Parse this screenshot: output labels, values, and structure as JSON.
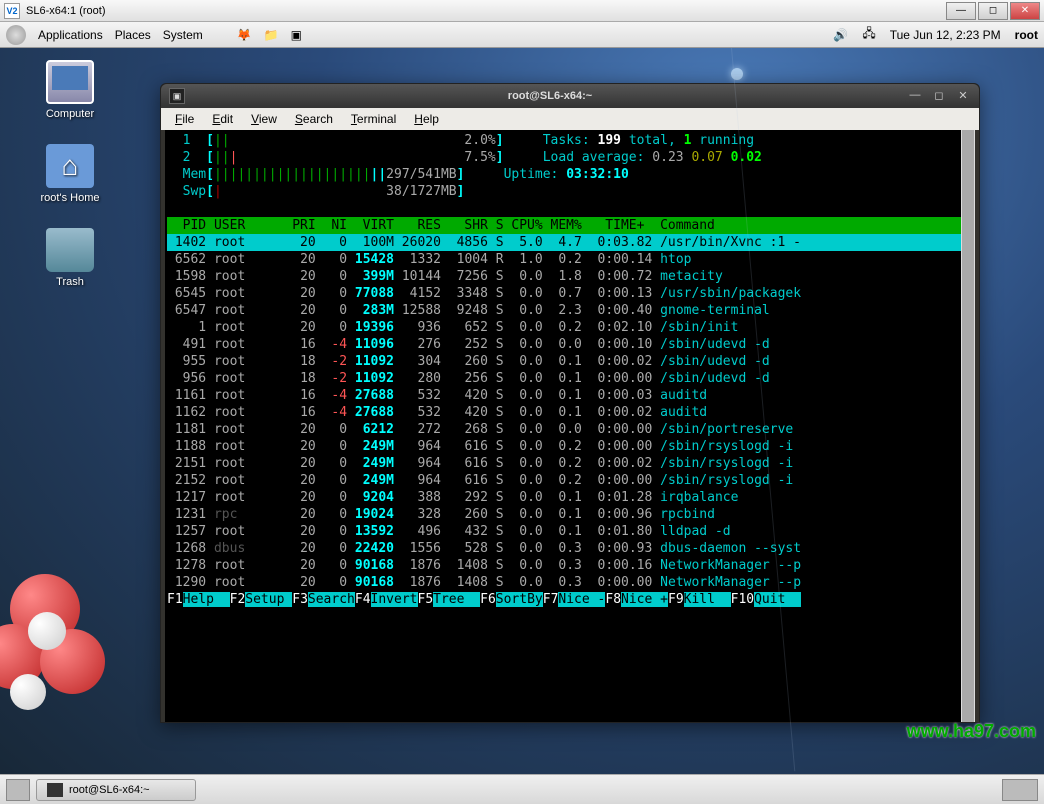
{
  "vnc": {
    "title": "SL6-x64:1 (root)",
    "icon": "V2"
  },
  "panel": {
    "menus": [
      "Applications",
      "Places",
      "System"
    ],
    "datetime": "Tue Jun 12,  2:23 PM",
    "user": "root"
  },
  "desktop_icons": [
    {
      "name": "computer",
      "label": "Computer"
    },
    {
      "name": "home",
      "label": "root's Home"
    },
    {
      "name": "trash",
      "label": "Trash"
    }
  ],
  "terminal": {
    "title": "root@SL6-x64:~",
    "menus": [
      "File",
      "Edit",
      "View",
      "Search",
      "Terminal",
      "Help"
    ]
  },
  "htop": {
    "cpus": [
      {
        "id": "1",
        "bar": "||",
        "bar2": "",
        "pct": "2.0%"
      },
      {
        "id": "2",
        "bar": "||",
        "bar2": "|",
        "pct": "7.5%"
      }
    ],
    "mem": {
      "bar": "||||||||||||||||||||",
      "bar2": "||",
      "text": "297/541MB"
    },
    "swp": {
      "bar": "|",
      "text": "38/1727MB"
    },
    "tasks_label": "Tasks: ",
    "tasks_total": "199",
    "tasks_total_suffix": " total, ",
    "tasks_running": "1",
    "tasks_running_suffix": " running",
    "load_label": "Load average: ",
    "load1": "0.23",
    "load2": "0.07",
    "load3": "0.02",
    "uptime_label": "Uptime: ",
    "uptime": "03:32:10",
    "columns": "  PID USER      PRI  NI  VIRT   RES   SHR S CPU% MEM%   TIME+  Command",
    "rows": [
      {
        "sel": true,
        "pid": " 1402",
        "user": "root      ",
        "pri": " 20",
        "ni": "  0",
        "virt": " 100M",
        "res": "26020",
        "shr": " 4856",
        "s": "S",
        "cpu": " 5.0",
        "mem": " 4.7",
        "time": " 0:03.82",
        "cmd": "/usr/bin/Xvnc :1 -"
      },
      {
        "pid": " 6562",
        "user": "root      ",
        "pri": " 20",
        "ni": "  0",
        "virt": "15428",
        "res": " 1332",
        "shr": " 1004",
        "s": "R",
        "cpu": " 1.0",
        "mem": " 0.2",
        "time": " 0:00.14",
        "cmd": "htop"
      },
      {
        "pid": " 1598",
        "user": "root      ",
        "pri": " 20",
        "ni": "  0",
        "virt": " 399M",
        "res": "10144",
        "shr": " 7256",
        "s": "S",
        "cpu": " 0.0",
        "mem": " 1.8",
        "time": " 0:00.72",
        "cmd": "metacity"
      },
      {
        "pid": " 6545",
        "user": "root      ",
        "pri": " 20",
        "ni": "  0",
        "virt": "77088",
        "res": " 4152",
        "shr": " 3348",
        "s": "S",
        "cpu": " 0.0",
        "mem": " 0.7",
        "time": " 0:00.13",
        "cmd": "/usr/sbin/packagek"
      },
      {
        "pid": " 6547",
        "user": "root      ",
        "pri": " 20",
        "ni": "  0",
        "virt": " 283M",
        "res": "12588",
        "shr": " 9248",
        "s": "S",
        "cpu": " 0.0",
        "mem": " 2.3",
        "time": " 0:00.40",
        "cmd": "gnome-terminal"
      },
      {
        "pid": "    1",
        "user": "root      ",
        "pri": " 20",
        "ni": "  0",
        "virt": "19396",
        "res": "  936",
        "shr": "  652",
        "s": "S",
        "cpu": " 0.0",
        "mem": " 0.2",
        "time": " 0:02.10",
        "cmd": "/sbin/init"
      },
      {
        "pid": "  491",
        "user": "root      ",
        "pri": " 16",
        "ni": " -4",
        "virt": "11096",
        "res": "  276",
        "shr": "  252",
        "s": "S",
        "cpu": " 0.0",
        "mem": " 0.0",
        "time": " 0:00.10",
        "cmd": "/sbin/udevd -d"
      },
      {
        "pid": "  955",
        "user": "root      ",
        "pri": " 18",
        "ni": " -2",
        "virt": "11092",
        "res": "  304",
        "shr": "  260",
        "s": "S",
        "cpu": " 0.0",
        "mem": " 0.1",
        "time": " 0:00.02",
        "cmd": "/sbin/udevd -d"
      },
      {
        "pid": "  956",
        "user": "root      ",
        "pri": " 18",
        "ni": " -2",
        "virt": "11092",
        "res": "  280",
        "shr": "  256",
        "s": "S",
        "cpu": " 0.0",
        "mem": " 0.1",
        "time": " 0:00.00",
        "cmd": "/sbin/udevd -d"
      },
      {
        "pid": " 1161",
        "user": "root      ",
        "pri": " 16",
        "ni": " -4",
        "virt": "27688",
        "res": "  532",
        "shr": "  420",
        "s": "S",
        "cpu": " 0.0",
        "mem": " 0.1",
        "time": " 0:00.03",
        "cmd": "auditd"
      },
      {
        "pid": " 1162",
        "user": "root      ",
        "pri": " 16",
        "ni": " -4",
        "virt": "27688",
        "res": "  532",
        "shr": "  420",
        "s": "S",
        "cpu": " 0.0",
        "mem": " 0.1",
        "time": " 0:00.02",
        "cmd": "auditd"
      },
      {
        "pid": " 1181",
        "user": "root      ",
        "pri": " 20",
        "ni": "  0",
        "virt": " 6212",
        "res": "  272",
        "shr": "  268",
        "s": "S",
        "cpu": " 0.0",
        "mem": " 0.0",
        "time": " 0:00.00",
        "cmd": "/sbin/portreserve"
      },
      {
        "pid": " 1188",
        "user": "root      ",
        "pri": " 20",
        "ni": "  0",
        "virt": " 249M",
        "res": "  964",
        "shr": "  616",
        "s": "S",
        "cpu": " 0.0",
        "mem": " 0.2",
        "time": " 0:00.00",
        "cmd": "/sbin/rsyslogd -i"
      },
      {
        "pid": " 2151",
        "user": "root      ",
        "pri": " 20",
        "ni": "  0",
        "virt": " 249M",
        "res": "  964",
        "shr": "  616",
        "s": "S",
        "cpu": " 0.0",
        "mem": " 0.2",
        "time": " 0:00.02",
        "cmd": "/sbin/rsyslogd -i"
      },
      {
        "pid": " 2152",
        "user": "root      ",
        "pri": " 20",
        "ni": "  0",
        "virt": " 249M",
        "res": "  964",
        "shr": "  616",
        "s": "S",
        "cpu": " 0.0",
        "mem": " 0.2",
        "time": " 0:00.00",
        "cmd": "/sbin/rsyslogd -i"
      },
      {
        "pid": " 1217",
        "user": "root      ",
        "pri": " 20",
        "ni": "  0",
        "virt": " 9204",
        "res": "  388",
        "shr": "  292",
        "s": "S",
        "cpu": " 0.0",
        "mem": " 0.1",
        "time": " 0:01.28",
        "cmd": "irqbalance"
      },
      {
        "pid": " 1231",
        "user": "rpc       ",
        "pri": " 20",
        "ni": "  0",
        "virt": "19024",
        "res": "  328",
        "shr": "  260",
        "s": "S",
        "cpu": " 0.0",
        "mem": " 0.1",
        "time": " 0:00.96",
        "cmd": "rpcbind"
      },
      {
        "pid": " 1257",
        "user": "root      ",
        "pri": " 20",
        "ni": "  0",
        "virt": "13592",
        "res": "  496",
        "shr": "  432",
        "s": "S",
        "cpu": " 0.0",
        "mem": " 0.1",
        "time": " 0:01.80",
        "cmd": "lldpad -d"
      },
      {
        "pid": " 1268",
        "user": "dbus      ",
        "pri": " 20",
        "ni": "  0",
        "virt": "22420",
        "res": " 1556",
        "shr": "  528",
        "s": "S",
        "cpu": " 0.0",
        "mem": " 0.3",
        "time": " 0:00.93",
        "cmd": "dbus-daemon --syst"
      },
      {
        "pid": " 1278",
        "user": "root      ",
        "pri": " 20",
        "ni": "  0",
        "virt": "90168",
        "res": " 1876",
        "shr": " 1408",
        "s": "S",
        "cpu": " 0.0",
        "mem": " 0.3",
        "time": " 0:00.16",
        "cmd": "NetworkManager --p"
      },
      {
        "pid": " 1290",
        "user": "root      ",
        "pri": " 20",
        "ni": "  0",
        "virt": "90168",
        "res": " 1876",
        "shr": " 1408",
        "s": "S",
        "cpu": " 0.0",
        "mem": " 0.3",
        "time": " 0:00.00",
        "cmd": "NetworkManager --p"
      }
    ],
    "fnkeys": [
      {
        "k": "F1",
        "l": "Help  "
      },
      {
        "k": "F2",
        "l": "Setup "
      },
      {
        "k": "F3",
        "l": "Search"
      },
      {
        "k": "F4",
        "l": "Invert"
      },
      {
        "k": "F5",
        "l": "Tree  "
      },
      {
        "k": "F6",
        "l": "SortBy"
      },
      {
        "k": "F7",
        "l": "Nice -"
      },
      {
        "k": "F8",
        "l": "Nice +"
      },
      {
        "k": "F9",
        "l": "Kill  "
      },
      {
        "k": "F10",
        "l": "Quit  "
      }
    ]
  },
  "taskbar": {
    "item": "root@SL6-x64:~"
  },
  "watermark": "www.ha97.com"
}
